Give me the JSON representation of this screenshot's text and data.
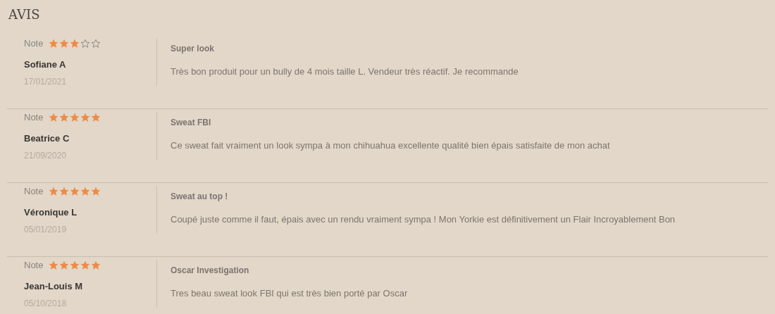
{
  "title": "AVIS",
  "reviews": [
    {
      "note_label": "Note",
      "stars": 3,
      "author": "Sofiane A",
      "date": "17/01/2021",
      "headline": "Super look",
      "text": "Très bon produit pour un bully de 4 mois taille L. Vendeur très réactif. Je recommande"
    },
    {
      "note_label": "Note",
      "stars": 5,
      "author": "Beatrice C",
      "date": "21/09/2020",
      "headline": "Sweat FBI",
      "text": "Ce sweat fait vraiment un look sympa à mon chihuahua excellente qualité bien épais satisfaite de mon achat"
    },
    {
      "note_label": "Note",
      "stars": 5,
      "author": "Véronique L",
      "date": "05/01/2019",
      "headline": "Sweat au top !",
      "text": "Coupé juste comme il faut, épais avec un rendu vraiment sympa ! Mon Yorkie est définitivement un Flair Incroyablement Bon"
    },
    {
      "note_label": "Note",
      "stars": 5,
      "author": "Jean-Louis M",
      "date": "05/10/2018",
      "headline": "Oscar Investigation",
      "text": "Tres beau sweat look FBI qui est très bien porté par Oscar"
    }
  ]
}
